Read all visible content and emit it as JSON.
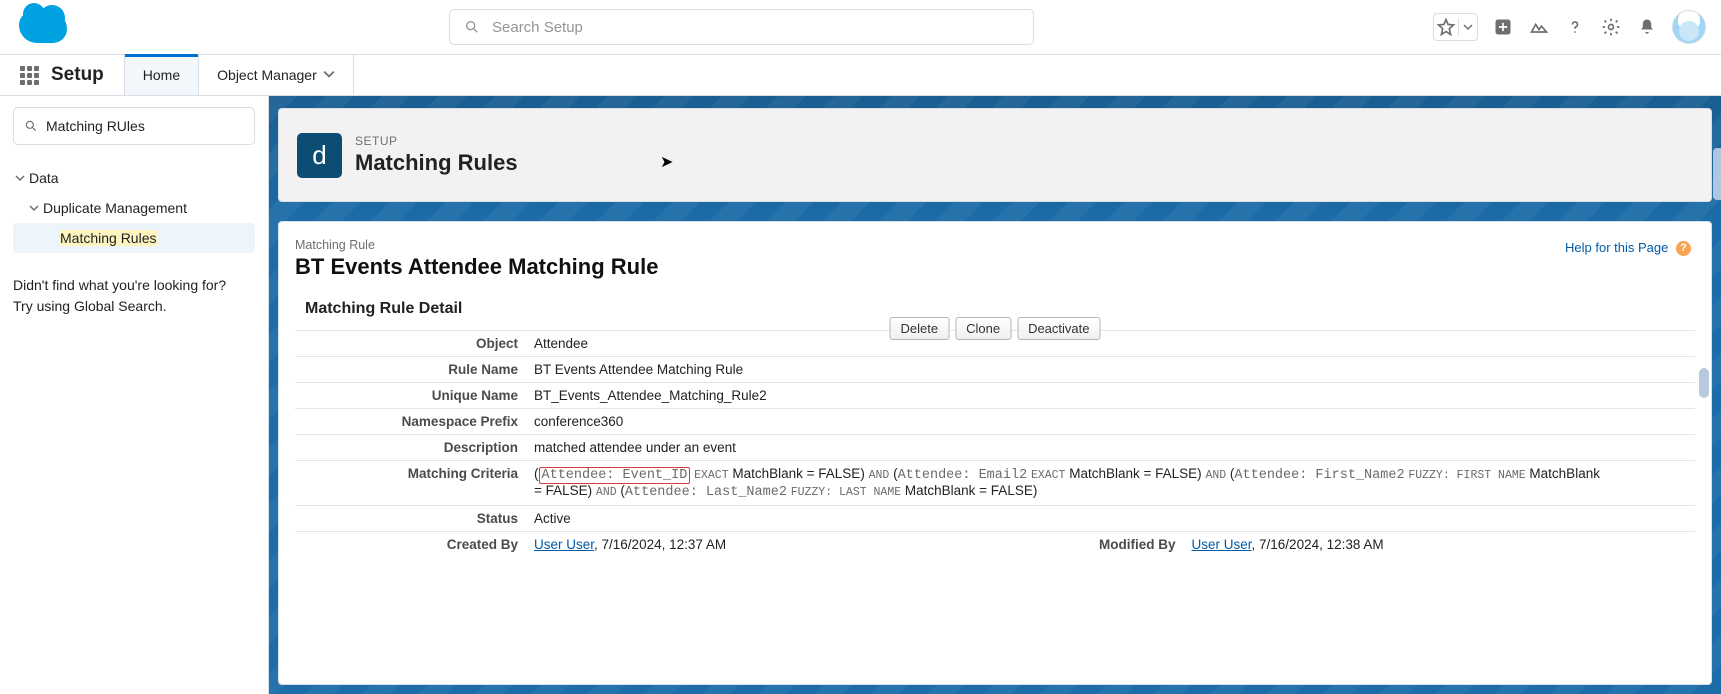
{
  "global": {
    "search_placeholder": "Search Setup"
  },
  "appbar": {
    "app_name": "Setup",
    "tabs": [
      {
        "label": "Home"
      },
      {
        "label": "Object Manager"
      }
    ]
  },
  "sidebar": {
    "search_value": "Matching RUles",
    "nodes": {
      "root": "Data",
      "child": "Duplicate Management",
      "leaf": "Matching Rules"
    },
    "hint_line1": "Didn't find what you're looking for?",
    "hint_line2": "Try using Global Search."
  },
  "header": {
    "eyebrow": "SETUP",
    "title": "Matching Rules",
    "icon_letter": "d"
  },
  "record": {
    "subtitle": "Matching Rule",
    "name_heading": "BT Events Attendee Matching Rule",
    "help_label": "Help for this Page",
    "section_title": "Matching Rule Detail",
    "buttons": {
      "delete": "Delete",
      "clone": "Clone",
      "deactivate": "Deactivate"
    },
    "rows": {
      "object_label": "Object",
      "object_value": "Attendee",
      "rulename_label": "Rule Name",
      "rulename_value": "BT Events Attendee Matching Rule",
      "unique_label": "Unique Name",
      "unique_value": "BT_Events_Attendee_Matching_Rule2",
      "ns_label": "Namespace Prefix",
      "ns_value": "conference360",
      "desc_label": "Description",
      "desc_value": "matched attendee under an event",
      "criteria_label": "Matching Criteria",
      "criteria": {
        "open1": "(",
        "field1": "Attendee: Event_ID",
        "mode1": "EXACT",
        "mb1": "MatchBlank = FALSE)",
        "and1": "AND",
        "open2": "(",
        "field2": "Attendee: Email2",
        "mode2": "EXACT",
        "mb2": "MatchBlank = FALSE)",
        "and2": "AND",
        "open3": "(",
        "field3": "Attendee: First_Name2",
        "mode3": "FUZZY: FIRST NAME",
        "mb3_pre": "MatchBlank",
        "mb3": "= FALSE)",
        "and3": "AND",
        "open4": "(",
        "field4": "Attendee: Last_Name2",
        "mode4": "FUZZY: LAST NAME",
        "mb4": "MatchBlank = FALSE)"
      },
      "status_label": "Status",
      "status_value": "Active",
      "created_label": "Created By",
      "created_user": "User User",
      "created_sep": ", ",
      "created_date": "7/16/2024, 12:37 AM",
      "modified_label": "Modified By",
      "modified_user": "User User",
      "modified_sep": ", ",
      "modified_date": "7/16/2024, 12:38 AM"
    }
  }
}
